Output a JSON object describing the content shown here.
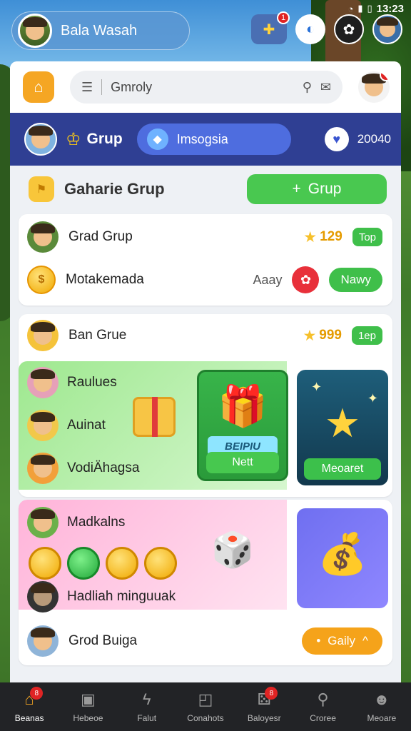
{
  "status_bar": {
    "time": "13:23"
  },
  "profile": {
    "name": "Bala Wasah"
  },
  "top_icons": {
    "gift_badge": "1"
  },
  "search": {
    "placeholder": "Gmroly",
    "avatar_badge": "!"
  },
  "tabs": {
    "grup_label": "Grup",
    "active_label": "Imsogsia",
    "right_value": "20040"
  },
  "group_header": {
    "title": "Gaharie Grup",
    "add_button": "Grup"
  },
  "card1": {
    "row1": {
      "label": "Grad Grup",
      "score": "129",
      "chip": "Top"
    },
    "row2": {
      "label": "Motakemada",
      "aux": "Aaay",
      "button": "Nawy"
    }
  },
  "card2": {
    "row1": {
      "label": "Ban Grue",
      "score": "999",
      "chip": "1ep"
    },
    "promo": {
      "items": [
        "Raulues",
        "Auinat",
        "VodiÄhagsa"
      ],
      "tile_green": {
        "label": "BEIPIU",
        "button": "Nett"
      },
      "tile_blue": {
        "button": "Meoaret"
      }
    }
  },
  "card3": {
    "promo": {
      "title": "Madkalns",
      "bottom_label": "Hadliah minguuak"
    },
    "row": {
      "label": "Grod Buiga",
      "button": "Gaily"
    }
  },
  "bottom_nav": {
    "items": [
      {
        "label": "Beanas",
        "badge": "8"
      },
      {
        "label": "Hebeoe"
      },
      {
        "label": "Falut"
      },
      {
        "label": "Conahots"
      },
      {
        "label": "Baloyesr",
        "badge": "8"
      },
      {
        "label": "Croree"
      },
      {
        "label": "Meoare"
      }
    ]
  },
  "colors": {
    "accent_green": "#3fbf4a",
    "accent_orange": "#f5a623",
    "tab_bar": "#2f3f93",
    "badge_red": "#e02424"
  }
}
